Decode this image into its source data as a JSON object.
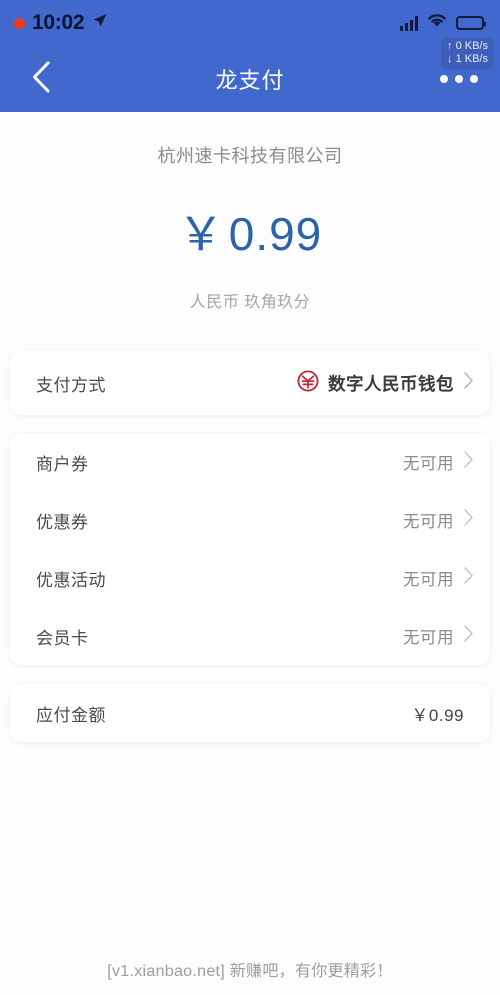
{
  "status_bar": {
    "time": "10:02",
    "recording_dot": "record-dot",
    "location_icon": "location-arrow-icon",
    "signal_icon": "cellular-signal-icon",
    "wifi_icon": "wifi-icon",
    "battery_icon": "battery-icon",
    "net_upload": "↑ 0 KB/s",
    "net_download": "↓ 1 KB/s"
  },
  "nav": {
    "back_icon": "back-chevron-icon",
    "title": "龙支付",
    "more_icon": "more-dots-icon"
  },
  "payment": {
    "merchant": "杭州速卡科技有限公司",
    "currency_symbol": "￥",
    "amount": "0.99",
    "amount_in_words": "人民币 玖角玖分"
  },
  "pay_method": {
    "label": "支付方式",
    "value": "数字人民币钱包",
    "icon": "ecny-logo-icon",
    "chevron": "chevron-right-icon"
  },
  "coupons": [
    {
      "label": "商户券",
      "value": "无可用"
    },
    {
      "label": "优惠券",
      "value": "无可用"
    },
    {
      "label": "优惠活动",
      "value": "无可用"
    },
    {
      "label": "会员卡",
      "value": "无可用"
    }
  ],
  "total": {
    "label": "应付金额",
    "value": "￥0.99"
  },
  "footer": {
    "watermark": "[v1.xianbao.net] 新赚吧，有你更精彩！"
  },
  "colors": {
    "header_blue": "#4169cd",
    "amount_blue": "#2b64ab",
    "ecny_red": "#c3262f",
    "background": "#fdfdfd"
  }
}
